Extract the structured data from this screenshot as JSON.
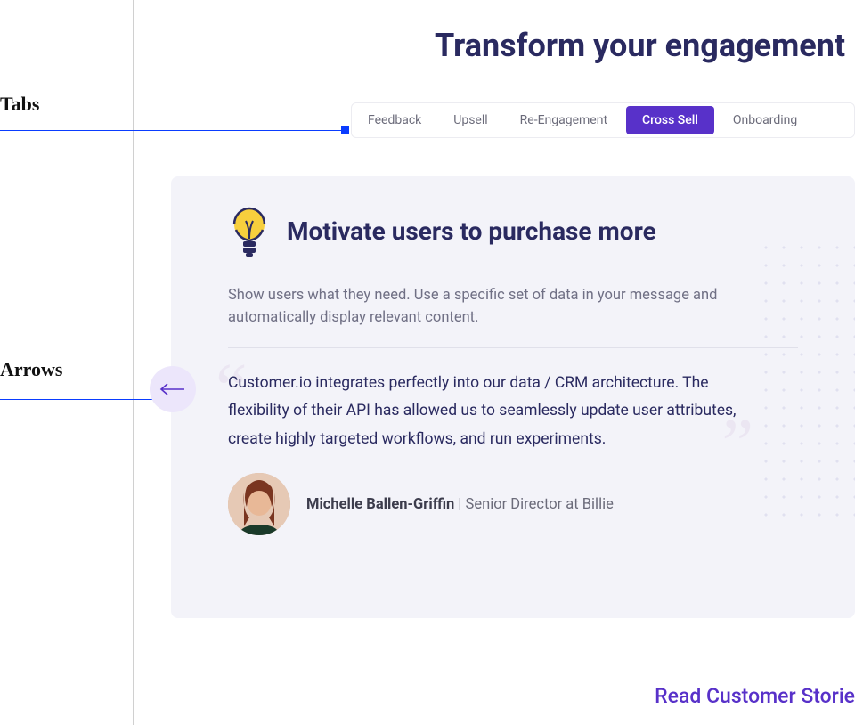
{
  "annotations": {
    "tabs_label": "Tabs",
    "arrows_label": "Arrows"
  },
  "page_title": "Transform your engagement",
  "tabs": [
    {
      "label": "Feedback",
      "active": false
    },
    {
      "label": "Upsell",
      "active": false
    },
    {
      "label": "Re-Engagement",
      "active": false
    },
    {
      "label": "Cross Sell",
      "active": true
    },
    {
      "label": "Onboarding",
      "active": false
    }
  ],
  "card": {
    "title": "Motivate users to purchase more",
    "description": "Show users what they need. Use a specific set of data in your message and automatically display relevant content.",
    "quote": "Customer.io integrates perfectly into our data / CRM architecture. The flexibility of their API has allowed us to seamlessly update user attributes, create highly targeted workflows, and run experiments.",
    "author_name": "Michelle Ballen-Griffin",
    "author_title": "Senior Director at Billie"
  },
  "read_link": "Read Customer Storie"
}
